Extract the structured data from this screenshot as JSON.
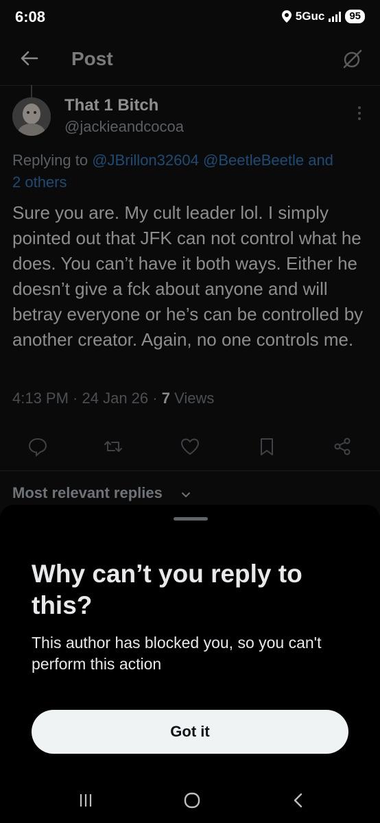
{
  "status_bar": {
    "time": "6:08",
    "network": "5Guc",
    "battery": "95"
  },
  "header": {
    "title": "Post"
  },
  "tweet": {
    "display_name": "That 1 Bitch",
    "handle": "@jackieandcocoa",
    "replying_prefix": "Replying to",
    "mentions": [
      "@JBrillon32604",
      "@BeetleBeetle",
      "and"
    ],
    "others": "2 others",
    "text": "Sure you are. My cult leader lol. I simply pointed out that JFK can not control what he does. You can’t have it both ways. Either he doesn’t give a fck about anyone and will betray everyone or he’s can be controlled by another creator. Again, no one controls me.",
    "time": "4:13 PM",
    "date": "24 Jan 26",
    "views_count": "7",
    "views_label": "Views"
  },
  "replies_filter": {
    "label": "Most relevant replies"
  },
  "sheet": {
    "title": "Why can’t you reply to this?",
    "message": "This author has blocked you, so you can't perform this action",
    "button": "Got it"
  },
  "icons": {
    "back": "arrow-left-icon",
    "grok": "grok-icon",
    "more": "more-vertical-icon",
    "reply": "reply-icon",
    "repost": "repost-icon",
    "like": "heart-icon",
    "bookmark": "bookmark-icon",
    "share": "share-icon"
  },
  "colors": {
    "background": "#000000",
    "link": "#1d9bf0",
    "button": "#eff3f4"
  }
}
